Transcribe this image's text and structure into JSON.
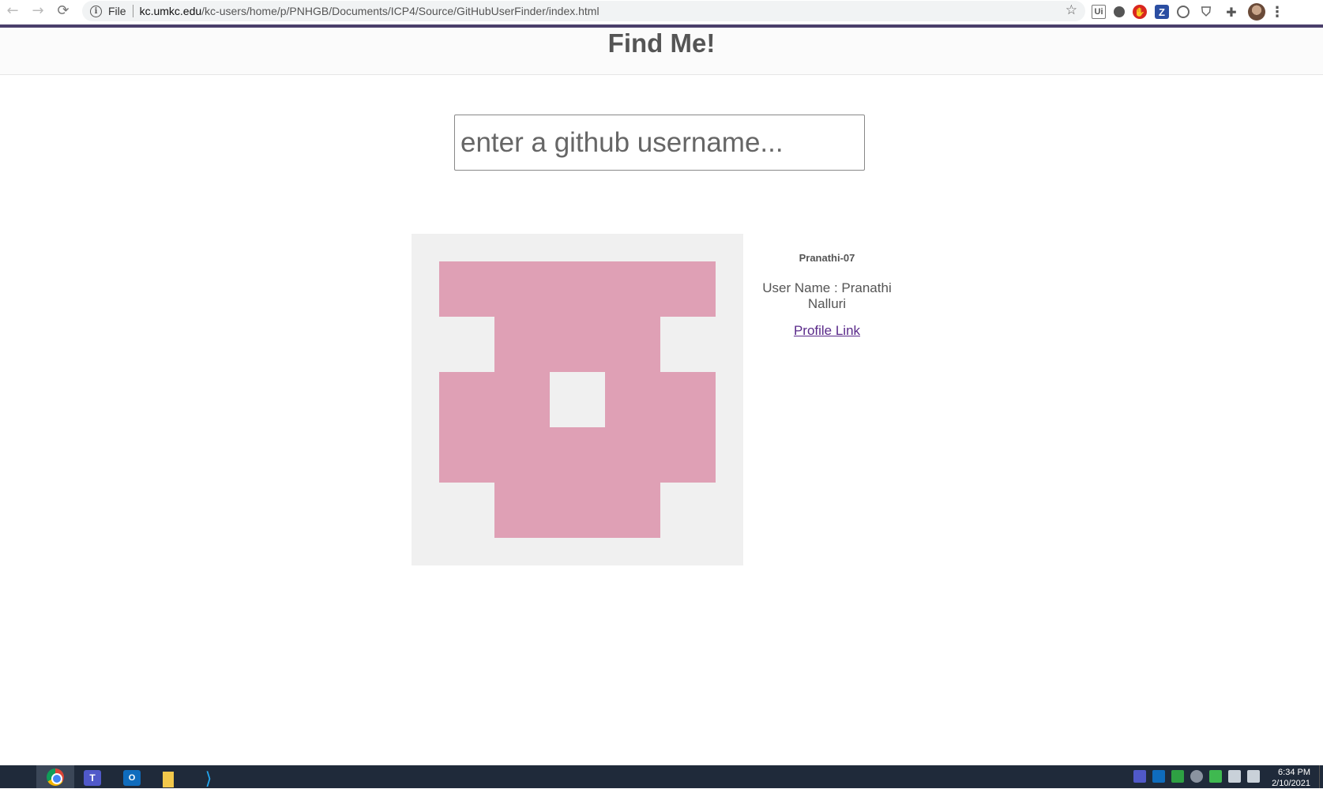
{
  "browser": {
    "back_glyph": "←",
    "forward_glyph": "→",
    "reload_glyph": "⟳",
    "info_glyph": "i",
    "scheme_label": "File",
    "url_host": "kc.umkc.edu",
    "url_path": "/kc-users/home/p/PNHGB/Documents/ICP4/Source/GitHubUserFinder/index.html",
    "star_glyph": "☆",
    "extensions": {
      "uipath_label": "Ui",
      "adblock_label": "✋",
      "zoom_label": "Z",
      "shield_glyph": "⛉",
      "puzzle_glyph": "✚",
      "menu_glyph": "⋮"
    },
    "accent_color": "#4a3f6b"
  },
  "page": {
    "title": "Find Me!",
    "search": {
      "placeholder": "enter a github username...",
      "value": ""
    },
    "profile": {
      "login": "Pranathi-07",
      "username_line": "User Name : Pranathi Nalluri",
      "profile_link_label": "Profile Link"
    },
    "identicon": {
      "color": "#dfa0b5",
      "grid": [
        [
          1,
          1,
          1,
          1,
          1
        ],
        [
          0,
          1,
          1,
          1,
          0
        ],
        [
          1,
          1,
          0,
          1,
          1
        ],
        [
          1,
          1,
          1,
          1,
          1
        ],
        [
          0,
          1,
          1,
          1,
          0
        ]
      ]
    }
  },
  "taskbar": {
    "teams_label": "T",
    "outlook_label": "O",
    "vscode_glyph": "⟩",
    "time": "6:34 PM",
    "date": "2/10/2021"
  }
}
